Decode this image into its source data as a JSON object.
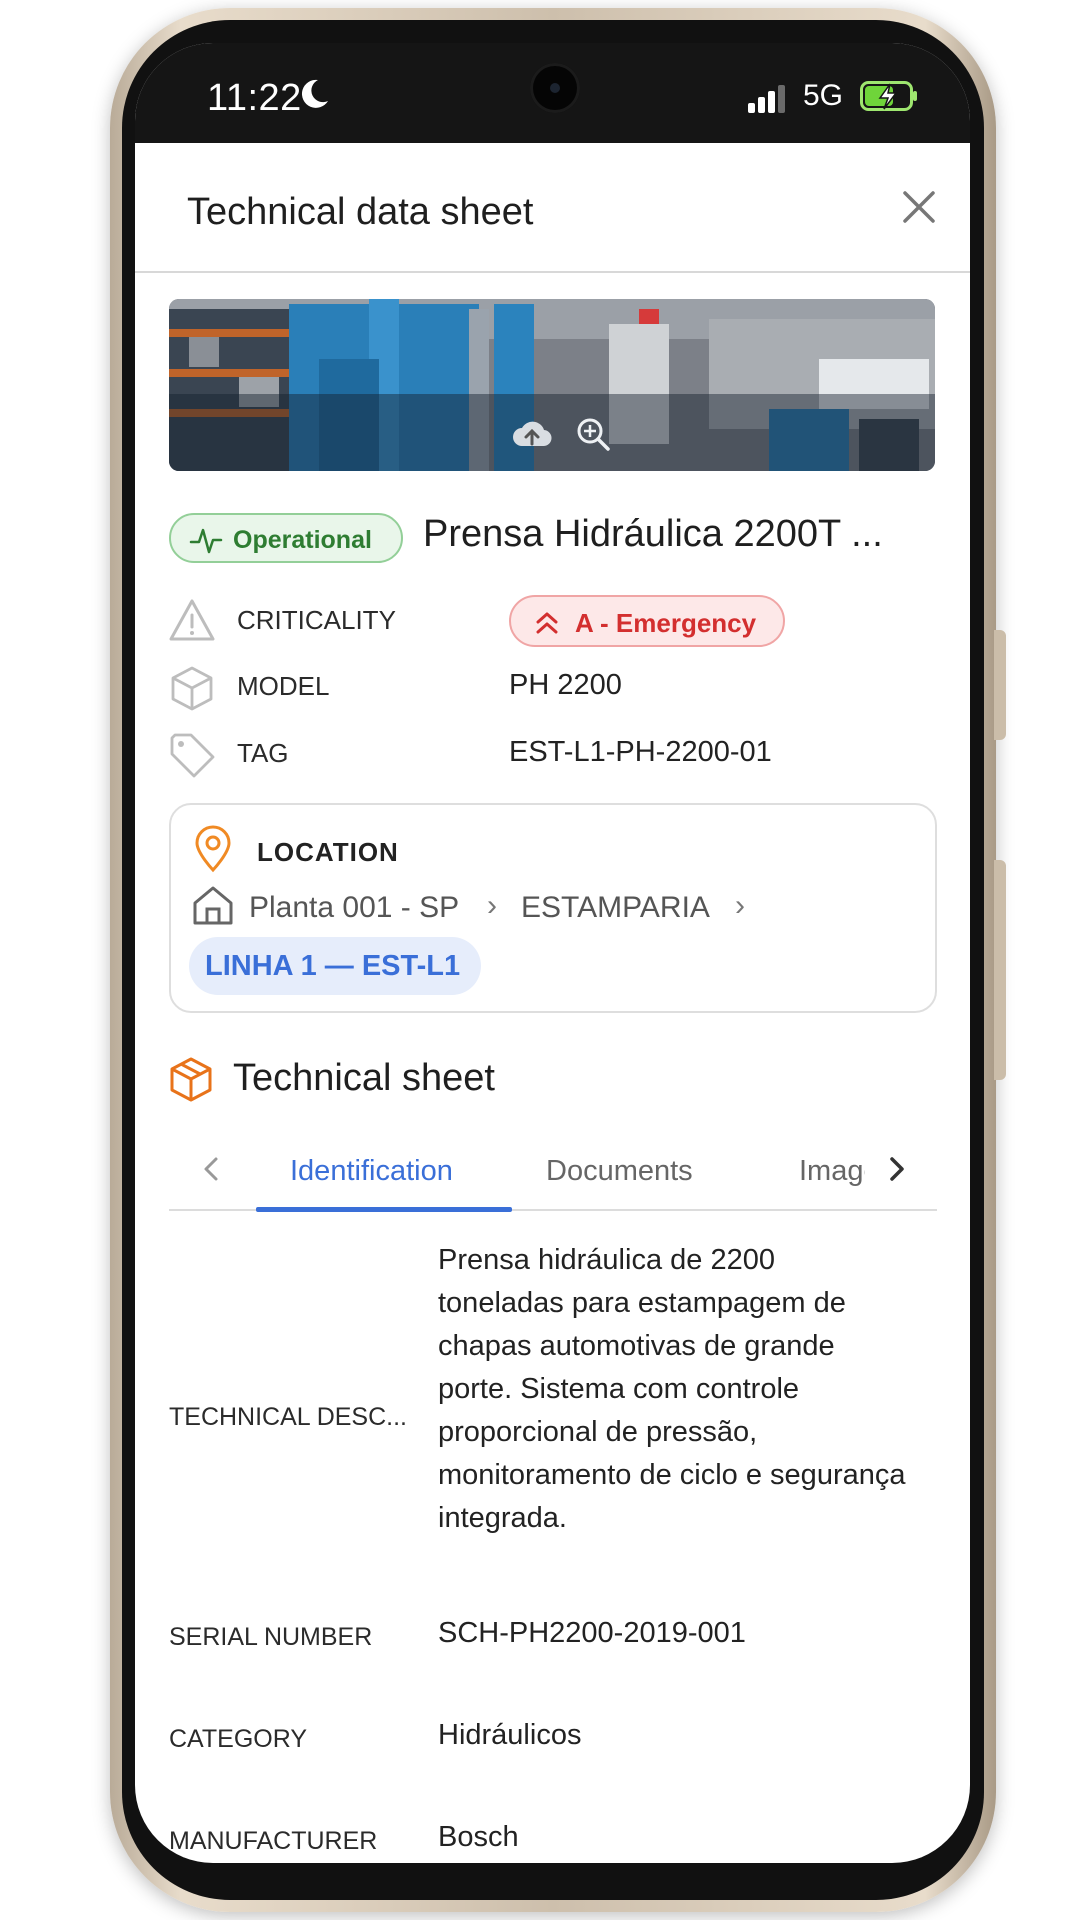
{
  "status_bar": {
    "time": "11:22",
    "network": "5G"
  },
  "header": {
    "title": "Technical data sheet"
  },
  "asset": {
    "status": "Operational",
    "name": "Prensa Hidráulica 2200T ...",
    "attributes": [
      {
        "label": "CRITICALITY",
        "value": "A - Emergency"
      },
      {
        "label": "MODEL",
        "value": "PH 2200"
      },
      {
        "label": "TAG",
        "value": "EST-L1-PH-2200-01"
      }
    ]
  },
  "location": {
    "title": "LOCATION",
    "breadcrumb": [
      "Planta 001 - SP",
      "ESTAMPARIA"
    ],
    "line": "LINHA 1 — EST-L1"
  },
  "technical_sheet": {
    "title": "Technical sheet",
    "tabs": [
      "Identification",
      "Documents",
      "Images"
    ],
    "details": [
      {
        "label": "TECHNICAL DESC...",
        "value": "Prensa hidráulica de 2200 toneladas para estampagem de chapas automotivas de grande porte. Sistema com controle proporcional de pressão, monitoramento de ciclo e segurança integrada."
      },
      {
        "label": "SERIAL NUMBER",
        "value": "SCH-PH2200-2019-001"
      },
      {
        "label": "CATEGORY",
        "value": "Hidráulicos"
      },
      {
        "label": "MANUFACTURER",
        "value": "Bosch"
      }
    ]
  },
  "colors": {
    "accent_blue": "#3a6fd8",
    "status_green": "#2e7d32",
    "emergency_red": "#d32f2f",
    "location_orange": "#f08a24"
  }
}
